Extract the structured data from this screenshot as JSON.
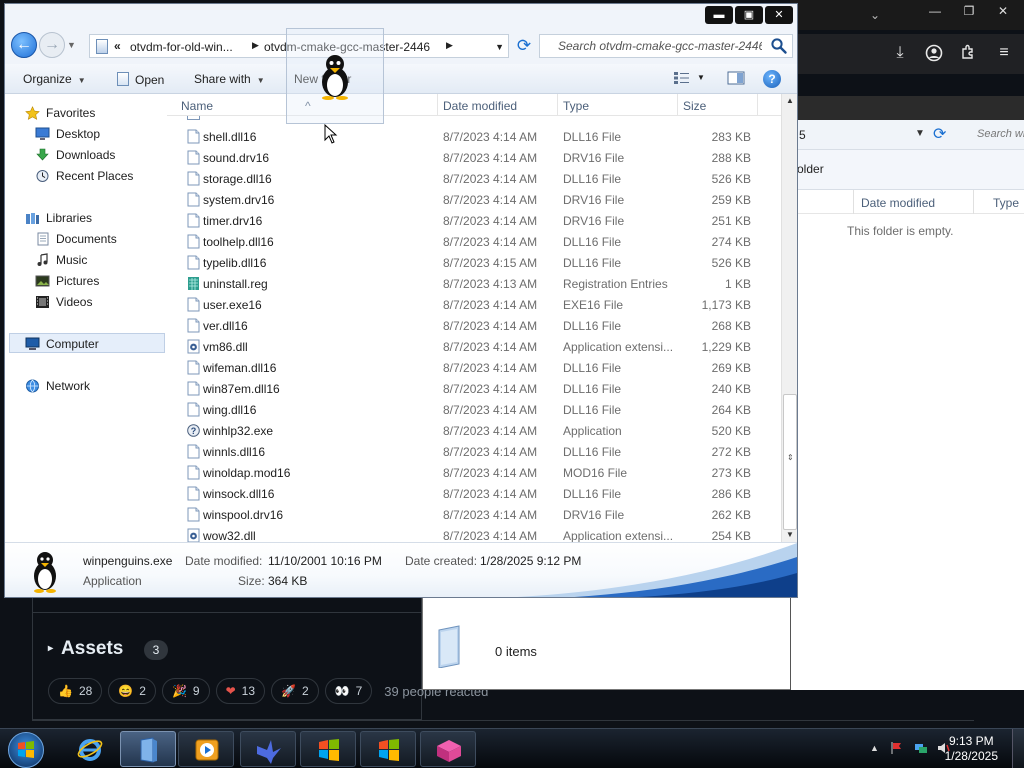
{
  "explorer": {
    "breadcrumb": [
      "otvdm-for-old-win...",
      "otvdm-cmake-gcc-master-2446"
    ],
    "search_placeholder": "Search otvdm-cmake-gcc-master-2446",
    "window_buttons": [
      "minimize",
      "maximize",
      "close"
    ],
    "commands": {
      "organize": "Organize",
      "open": "Open",
      "share_with": "Share with",
      "new_folder": "New folder"
    },
    "nav": {
      "favorites": "Favorites",
      "favorites_items": [
        "Desktop",
        "Downloads",
        "Recent Places"
      ],
      "libraries": "Libraries",
      "libraries_items": [
        "Documents",
        "Music",
        "Pictures",
        "Videos"
      ],
      "computer": "Computer",
      "network": "Network"
    },
    "columns": {
      "name": "Name",
      "date": "Date modified",
      "type": "Type",
      "size": "Size"
    },
    "files": [
      {
        "name": "shell.dll16",
        "date": "8/7/2023 4:14 AM",
        "type": "DLL16 File",
        "size": "283 KB",
        "icon": "generic-file-icon"
      },
      {
        "name": "sound.drv16",
        "date": "8/7/2023 4:14 AM",
        "type": "DRV16 File",
        "size": "288 KB",
        "icon": "generic-file-icon"
      },
      {
        "name": "storage.dll16",
        "date": "8/7/2023 4:14 AM",
        "type": "DLL16 File",
        "size": "526 KB",
        "icon": "generic-file-icon"
      },
      {
        "name": "system.drv16",
        "date": "8/7/2023 4:14 AM",
        "type": "DRV16 File",
        "size": "259 KB",
        "icon": "generic-file-icon"
      },
      {
        "name": "timer.drv16",
        "date": "8/7/2023 4:14 AM",
        "type": "DRV16 File",
        "size": "251 KB",
        "icon": "generic-file-icon"
      },
      {
        "name": "toolhelp.dll16",
        "date": "8/7/2023 4:14 AM",
        "type": "DLL16 File",
        "size": "274 KB",
        "icon": "generic-file-icon"
      },
      {
        "name": "typelib.dll16",
        "date": "8/7/2023 4:15 AM",
        "type": "DLL16 File",
        "size": "526 KB",
        "icon": "generic-file-icon"
      },
      {
        "name": "uninstall.reg",
        "date": "8/7/2023 4:13 AM",
        "type": "Registration Entries",
        "size": "1 KB",
        "icon": "registry-file-icon"
      },
      {
        "name": "user.exe16",
        "date": "8/7/2023 4:14 AM",
        "type": "EXE16 File",
        "size": "1,173 KB",
        "icon": "generic-file-icon"
      },
      {
        "name": "ver.dll16",
        "date": "8/7/2023 4:14 AM",
        "type": "DLL16 File",
        "size": "268 KB",
        "icon": "generic-file-icon"
      },
      {
        "name": "vm86.dll",
        "date": "8/7/2023 4:14 AM",
        "type": "Application extensi...",
        "size": "1,229 KB",
        "icon": "dll-gear-icon"
      },
      {
        "name": "wifeman.dll16",
        "date": "8/7/2023 4:14 AM",
        "type": "DLL16 File",
        "size": "269 KB",
        "icon": "generic-file-icon"
      },
      {
        "name": "win87em.dll16",
        "date": "8/7/2023 4:14 AM",
        "type": "DLL16 File",
        "size": "240 KB",
        "icon": "generic-file-icon"
      },
      {
        "name": "wing.dll16",
        "date": "8/7/2023 4:14 AM",
        "type": "DLL16 File",
        "size": "264 KB",
        "icon": "generic-file-icon"
      },
      {
        "name": "winhlp32.exe",
        "date": "8/7/2023 4:14 AM",
        "type": "Application",
        "size": "520 KB",
        "icon": "help-app-icon"
      },
      {
        "name": "winnls.dll16",
        "date": "8/7/2023 4:14 AM",
        "type": "DLL16 File",
        "size": "272 KB",
        "icon": "generic-file-icon"
      },
      {
        "name": "winoldap.mod16",
        "date": "8/7/2023 4:14 AM",
        "type": "MOD16 File",
        "size": "273 KB",
        "icon": "generic-file-icon"
      },
      {
        "name": "winsock.dll16",
        "date": "8/7/2023 4:14 AM",
        "type": "DLL16 File",
        "size": "286 KB",
        "icon": "generic-file-icon"
      },
      {
        "name": "winspool.drv16",
        "date": "8/7/2023 4:14 AM",
        "type": "DRV16 File",
        "size": "262 KB",
        "icon": "generic-file-icon"
      },
      {
        "name": "wow32.dll",
        "date": "8/7/2023 4:14 AM",
        "type": "Application extensi...",
        "size": "254 KB",
        "icon": "dll-gear-icon"
      }
    ],
    "details": {
      "name": "winpenguins.exe",
      "kind": "Application",
      "date_modified_label": "Date modified:",
      "date_modified": "11/10/2001 10:16 PM",
      "date_created_label": "Date created:",
      "date_created": "1/28/2025 9:12 PM",
      "size_label": "Size:",
      "size": "364 KB"
    }
  },
  "explorer2": {
    "address_tail": "5",
    "search_placeholder": "Search wi",
    "toolbar_tail": "older",
    "col_date": "Date modified",
    "col_type": "Type",
    "empty_text": "This folder is empty.",
    "items_count": "0 items"
  },
  "background_page": {
    "assets_title": "Assets",
    "assets_count": "3",
    "reactions": [
      {
        "emoji": "👍",
        "count": "28"
      },
      {
        "emoji": "😄",
        "count": "2"
      },
      {
        "emoji": "🎉",
        "count": "9"
      },
      {
        "emoji": "❤",
        "count": "13"
      },
      {
        "emoji": "🚀",
        "count": "2"
      },
      {
        "emoji": "👀",
        "count": "7"
      }
    ],
    "reacted_text": "39 people reacted"
  },
  "taskbar": {
    "clock_time": "9:13 PM",
    "clock_date": "1/28/2025",
    "apps": [
      "internet-explorer-icon",
      "file-explorer-icon",
      "media-player-icon",
      "bird-app-icon",
      "windows-flag-icon",
      "windows-flag-icon",
      "pink-box-app-icon"
    ]
  },
  "colors": {
    "accent": "#1a6fd1",
    "background_dark": "#0d1117",
    "taskbar": "#0b1118"
  }
}
